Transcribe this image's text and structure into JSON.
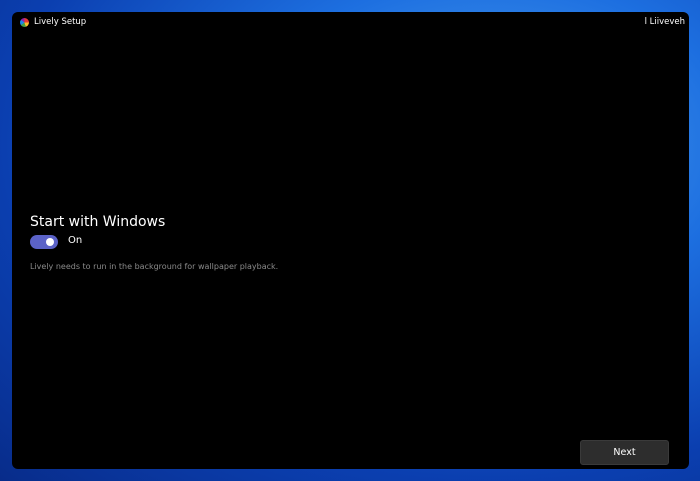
{
  "window": {
    "title": "Lively Setup",
    "title_right": "l Liiveveh"
  },
  "setting": {
    "heading": "Start with Windows",
    "toggle_state": "On",
    "toggle_on": true,
    "description": "Lively needs to run in the background for wallpaper playback."
  },
  "footer": {
    "next_label": "Next"
  },
  "colors": {
    "accent": "#5b62c7"
  }
}
